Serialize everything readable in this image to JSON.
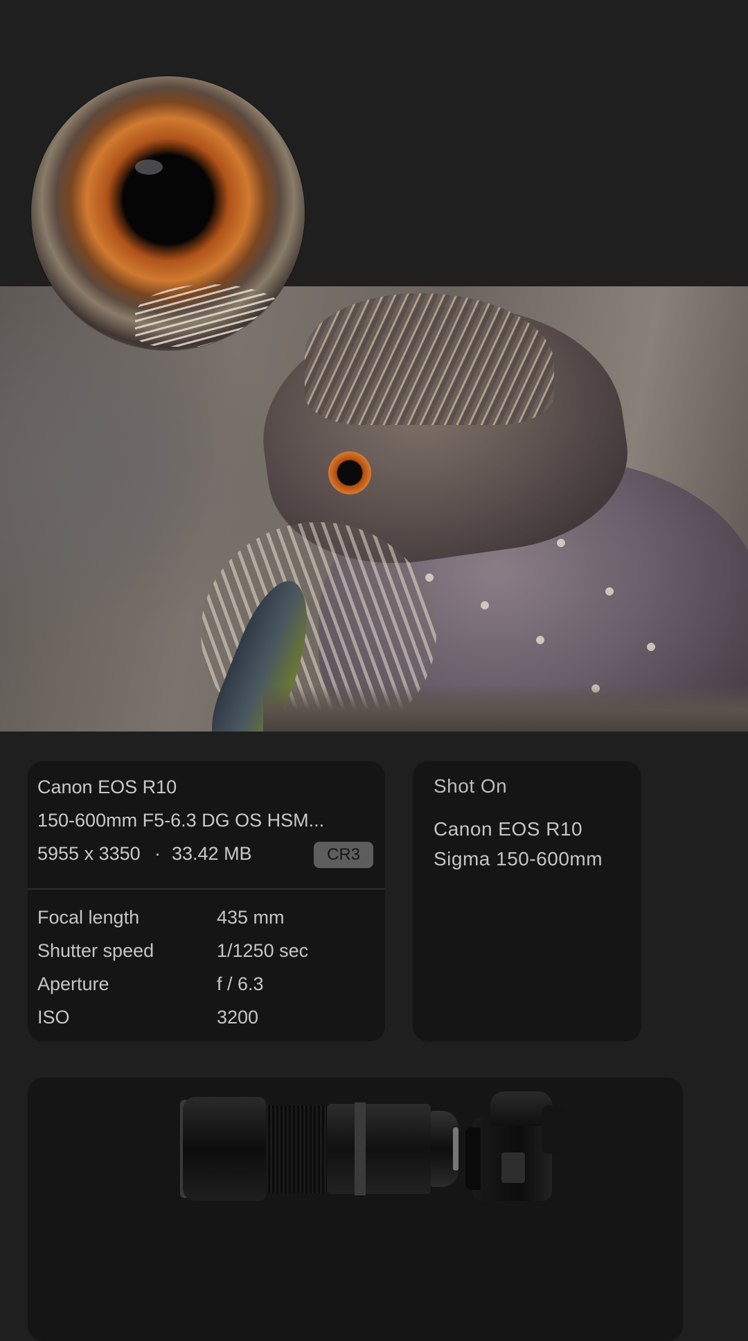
{
  "photo": {
    "subject": "bird-photo",
    "zoom_detail": "eye-closeup"
  },
  "file_info": {
    "camera": "Canon EOS R10",
    "lens": "150-600mm F5-6.3 DG OS HSM...",
    "dimensions": "5955 x 3350",
    "separator": "·",
    "file_size": "33.42 MB",
    "format_badge": "CR3"
  },
  "exif": [
    {
      "label": "Focal length",
      "value": "435 mm"
    },
    {
      "label": "Shutter speed",
      "value": "1/1250 sec"
    },
    {
      "label": "Aperture",
      "value": "f / 6.3"
    },
    {
      "label": "ISO",
      "value": "3200"
    }
  ],
  "shot_on": {
    "title": "Shot On",
    "lines": [
      "Canon EOS R10",
      "Sigma 150-600mm"
    ]
  },
  "gear": {
    "items": [
      "lens-image",
      "camera-image"
    ]
  },
  "colors": {
    "background": "#1f1f1f",
    "card": "#151515",
    "badge": "#5d5d5d"
  }
}
